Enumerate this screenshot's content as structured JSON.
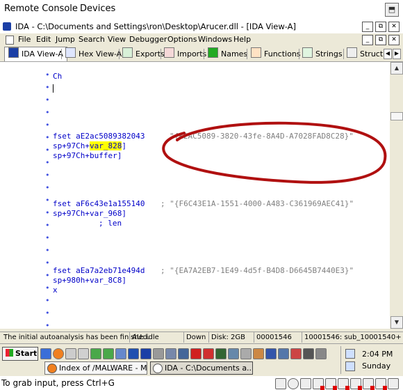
{
  "remote_console": {
    "menu": [
      "Remote Console",
      "Devices"
    ],
    "maximize_glyph": "⬒"
  },
  "ida": {
    "title": "IDA - C:\\Documents and Settings\\ron\\Desktop\\Arucer.dll - [IDA View-A]",
    "window_buttons": [
      "_",
      "⧉",
      "✕"
    ],
    "menu": [
      "File",
      "Edit",
      "Jump",
      "Search",
      "View",
      "Debugger",
      "Options",
      "Windows",
      "Help"
    ],
    "tabs": [
      {
        "label": "IDA View-A",
        "icon": "ida-view-icon",
        "color": "#1b3fa6"
      },
      {
        "label": "Hex View-A",
        "icon": "hex-view-icon",
        "color": "#1b3fa6"
      },
      {
        "label": "Exports",
        "icon": "exports-icon",
        "color": "#0a7a2a"
      },
      {
        "label": "Imports",
        "icon": "imports-icon",
        "color": "#c0392b"
      },
      {
        "label": "Names",
        "icon": "names-icon",
        "color": "#22aa22"
      },
      {
        "label": "Functions",
        "icon": "functions-icon",
        "color": "#d06000"
      },
      {
        "label": "Strings",
        "icon": "strings-icon",
        "color": "#22aa22"
      },
      {
        "label": "Structu",
        "icon": "structures-icon",
        "color": "#333333"
      }
    ],
    "code": {
      "line1": "Ch",
      "guid1_label": "fset aE2ac5089382043",
      "guid1_string": "\"{E2AC5089-3820-43fe-8A4D-A7028FAD8C28}\"",
      "guid1_op1_prefix": "sp+97Ch+",
      "guid1_op1_var": "var_828",
      "guid1_op1_suffix": "]",
      "guid1_op2": "sp+97Ch+buffer]",
      "guid2_label": "fset aF6c43e1a155140",
      "guid2_string": "; \"{F6C43E1A-1551-4000-A483-C361969AEC41}\"",
      "guid2_op1": "sp+97Ch+var_968]",
      "guid2_comment": "; len",
      "guid3_label": "fset aEa7a2eb71e494d",
      "guid3_string": "; \"{EA7A2EB7-1E49-4d5f-B4D8-D6645B7440E3}\"",
      "guid3_op1": "sp+980h+var_8C8]",
      "guid3_op2": "x"
    },
    "annotation_color": "#b01010",
    "status": {
      "message": "The initial autoanalysis has been finished.",
      "au": "AU:  idle",
      "direction": "Down",
      "disk": "Disk: 2GB",
      "address": "00001546",
      "location": "10001546: sub_10001540+"
    }
  },
  "taskbar": {
    "start_label": "Start",
    "tasks": [
      {
        "label": "Index of /MALWARE - M..."
      },
      {
        "label": "IDA - C:\\Documents a..."
      }
    ],
    "time": "2:04 PM",
    "day": "Sunday"
  },
  "footer": {
    "hint": "To grab input, press Ctrl+G"
  }
}
